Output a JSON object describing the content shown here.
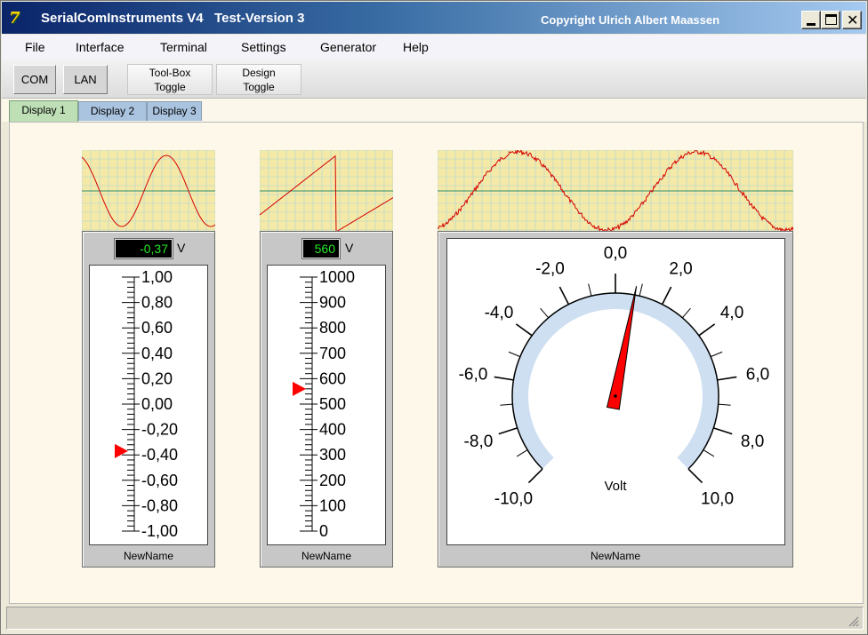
{
  "window": {
    "icon_glyph": "7",
    "title": "SerialComInstruments V4   Test-Version 3",
    "copyright": "Copyright Ulrich Albert Maassen",
    "close_glyph": "✕"
  },
  "menu": [
    "File",
    "Interface",
    "Terminal",
    "Settings",
    "Generator",
    "Help"
  ],
  "toolbar": {
    "com_label": "COM",
    "lan_label": "LAN",
    "toolbox_label_1": "Tool-Box",
    "toolbox_label_2": "Toggle",
    "design_label_1": "Design",
    "design_label_2": "Toggle"
  },
  "tabs": [
    "Display 1",
    "Display 2",
    "Display 3"
  ],
  "active_tab": 0,
  "instruments": {
    "linear_left": {
      "value_text": "-0,37",
      "value": -0.37,
      "unit": "V",
      "name": "NewName",
      "min": -1.0,
      "max": 1.0,
      "labels": [
        "1,00",
        "0,80",
        "0,60",
        "0,40",
        "0,20",
        "0,00",
        "-0,20",
        "-0,40",
        "-0,60",
        "-0,80",
        "-1,00"
      ],
      "scope_signal": "sine"
    },
    "linear_mid": {
      "value_text": "560",
      "value": 560,
      "unit": "V",
      "name": "NewName",
      "min": 0,
      "max": 1000,
      "labels": [
        "1000",
        "900",
        "800",
        "700",
        "600",
        "500",
        "400",
        "300",
        "200",
        "100",
        "0"
      ],
      "scope_signal": "sawtooth"
    },
    "round_gauge": {
      "value": 0.8,
      "min": -10,
      "max": 10,
      "unit_label": "Volt",
      "name": "NewName",
      "labels": [
        "-10,0",
        "-8,0",
        "-6,0",
        "-4,0",
        "-2,0",
        "0,0",
        "2,0",
        "4,0",
        "6,0",
        "8,0",
        "10,0"
      ],
      "scope_signal": "noisy-sine"
    }
  },
  "colors": {
    "scope_bg": "#f5e9a8",
    "scope_grid": "#a9d6d6",
    "scope_axis": "#2f8f6f",
    "signal": "#d40000",
    "pointer": "#ff0000",
    "digital_text": "#23e623",
    "arc": "#cddff0"
  }
}
